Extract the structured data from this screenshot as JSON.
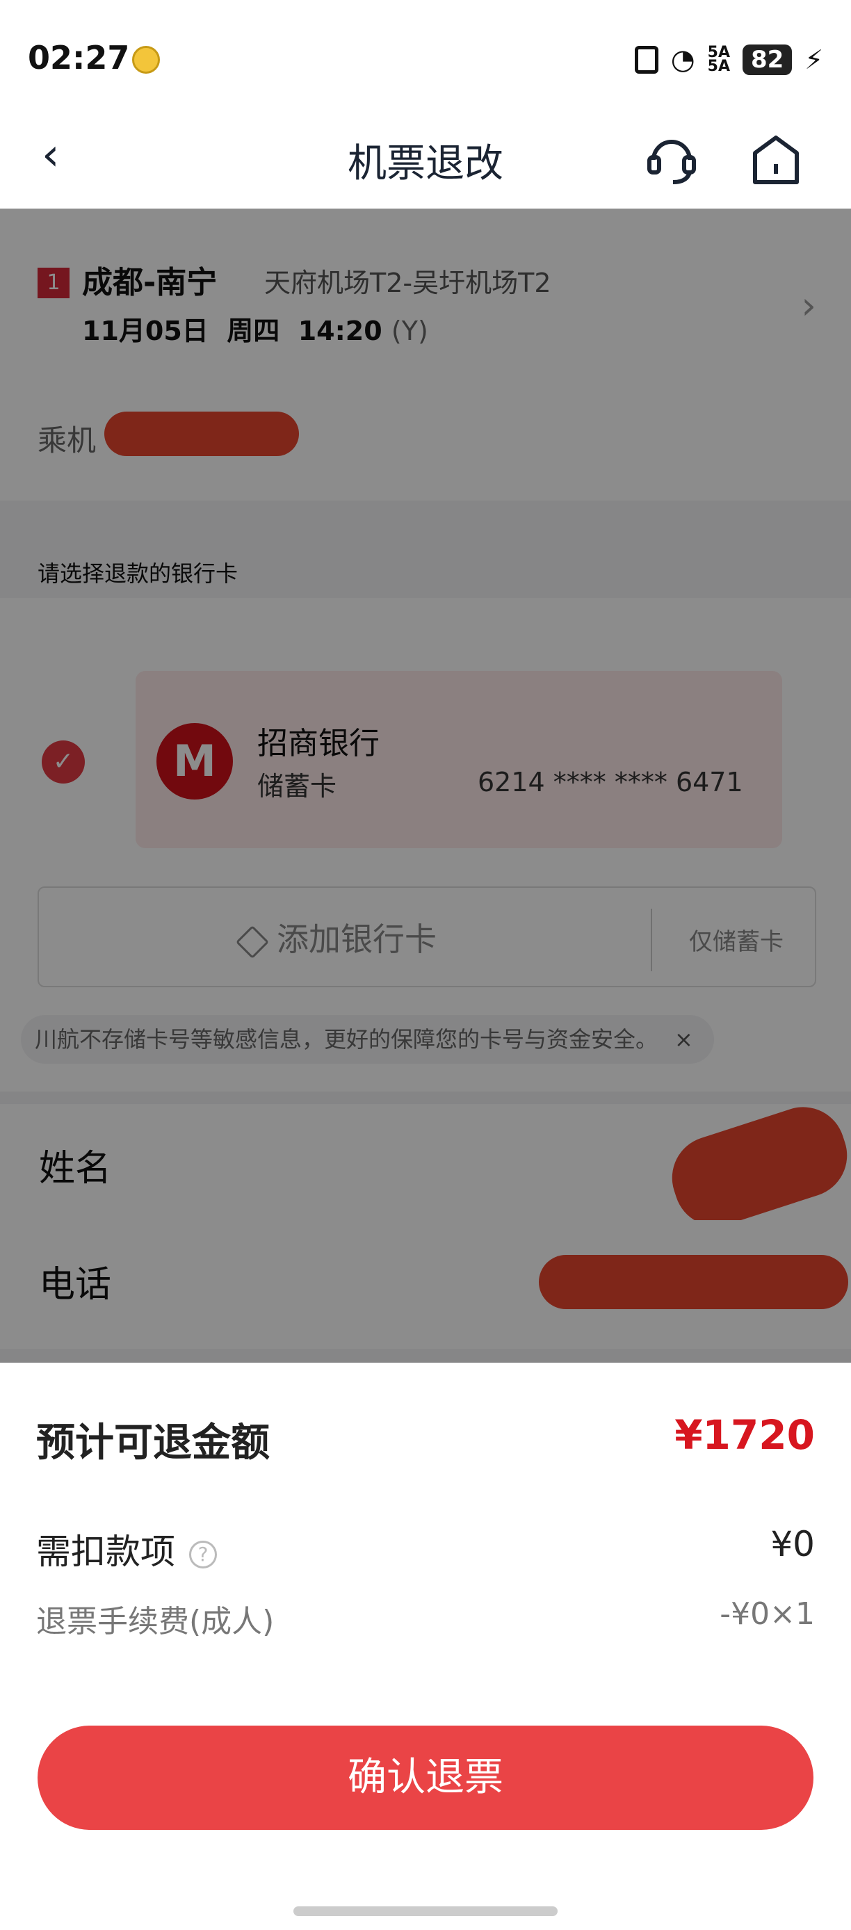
{
  "status_bar": {
    "time": "02:27",
    "signal_text": "5A\n5A",
    "battery": "82"
  },
  "nav": {
    "title": "机票退改"
  },
  "flight": {
    "segment_index": "1",
    "route": "成都-南宁",
    "airports": "天府机场T2-吴圩机场T2",
    "date": "11月05日",
    "weekday": "周四",
    "time": "14:20",
    "cabin": "(Y)"
  },
  "passenger": {
    "label": "乘机"
  },
  "bank": {
    "section_label": "请选择退款的银行卡",
    "bank_name": "招商银行",
    "card_type": "储蓄卡",
    "card_number": "6214 **** **** 6471",
    "add_card_label": "添加银行卡",
    "debit_only_label": "仅储蓄卡",
    "notice": "川航不存储卡号等敏感信息，更好的保障您的卡号与资金安全。",
    "notice_close": "×"
  },
  "contact": {
    "name_label": "姓名",
    "phone_label": "电话"
  },
  "refund": {
    "estimate_label": "预计可退金额",
    "estimate_amount": "¥1720",
    "deduct_label": "需扣款项",
    "deduct_amount": "¥0",
    "fee_label": "退票手续费(成人)",
    "fee_amount": "-¥0×1",
    "confirm_label": "确认退票"
  },
  "colors": {
    "accent_red": "#ea4446",
    "amount_red": "#d7161f"
  }
}
